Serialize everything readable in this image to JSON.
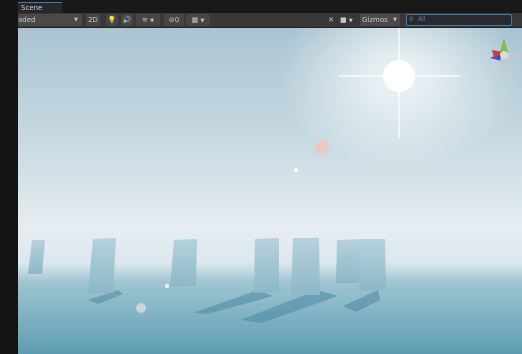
{
  "tab": {
    "label": "Scene"
  },
  "toolbar": {
    "draw_mode": "aded",
    "toggle_2d": "2D",
    "hidden_count": "0",
    "gizmos_label": "Gizmos",
    "search_placeholder": "All"
  },
  "icons": {
    "caret": "▼",
    "light": "💡",
    "audio": "🔊",
    "effects": "≋",
    "hidden": "⊘",
    "grid": "▦",
    "tools": "✕",
    "camera": "■",
    "search": "⚲",
    "more": "⋮"
  },
  "colors": {
    "accent": "#3a79bb",
    "toolbar": "#383838",
    "sky_top": "#a6c3d0",
    "horizon": "#e8eef1",
    "water": "#5f9eb2"
  }
}
